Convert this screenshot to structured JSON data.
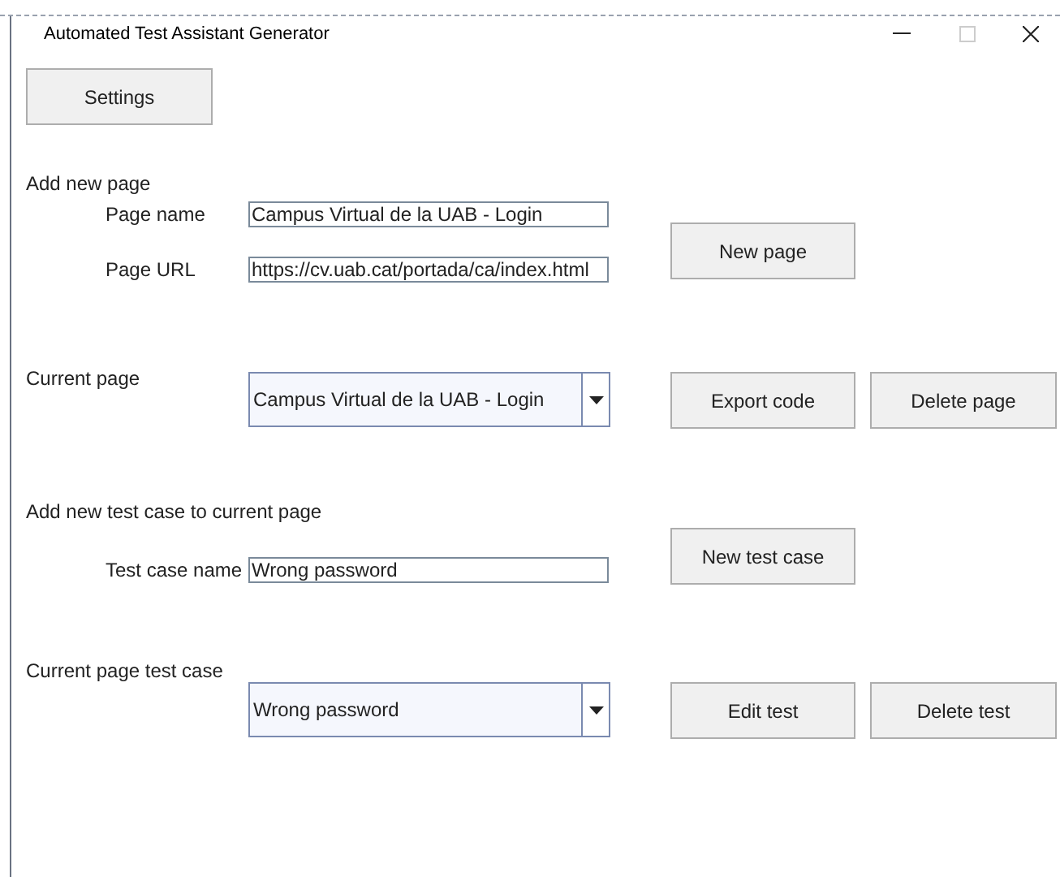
{
  "window": {
    "title": "Automated Test Assistant Generator"
  },
  "settings_button": "Settings",
  "add_page": {
    "heading": "Add new page",
    "name_label": "Page name",
    "name_value": "Campus Virtual de la UAB - Login",
    "url_label": "Page URL",
    "url_value": "https://cv.uab.cat/portada/ca/index.html",
    "button": "New page"
  },
  "current_page": {
    "heading": "Current page",
    "value": "Campus Virtual de la UAB - Login",
    "buttons": [
      "Export code",
      "Delete page"
    ]
  },
  "add_test": {
    "heading": "Add new test case to current page",
    "name_label": "Test case name",
    "name_value": "Wrong password",
    "button": "New test case"
  },
  "current_test": {
    "heading": "Current page test case",
    "value": "Wrong password",
    "buttons": [
      "Edit test",
      "Delete test"
    ]
  }
}
